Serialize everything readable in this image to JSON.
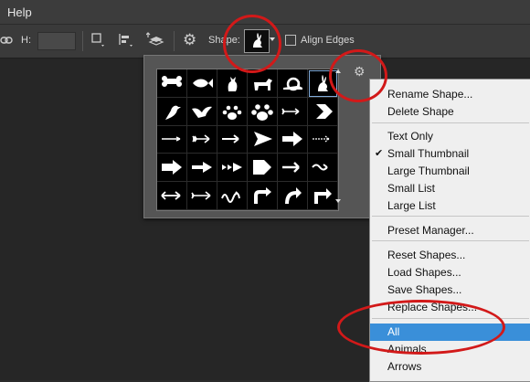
{
  "menubar": {
    "help_label": "Help"
  },
  "options": {
    "h_label": "H:",
    "shape_label": "Shape:",
    "align_edges_label": "Align Edges"
  },
  "shape_grid": {
    "rows": [
      [
        "bone",
        "fish",
        "cat",
        "dog",
        "snail",
        "rabbit"
      ],
      [
        "bird",
        "dove",
        "paw",
        "paw-print",
        "arrow-feathered",
        "chevron"
      ],
      [
        "arrow-thin",
        "arrow-feather",
        "arrow-line",
        "arrow-triangle",
        "arrow-bold",
        "arrow-dotted"
      ],
      [
        "arrow-block",
        "arrow-split",
        "arrow-triple",
        "arrow-pentagon",
        "arrow-plain",
        "arrow-wave"
      ],
      [
        "arrow-double",
        "arrow-double-line",
        "arrow-squiggle",
        "arrow-turn",
        "arrow-curve",
        "arrow-corner"
      ]
    ],
    "selected": "rabbit"
  },
  "menu": {
    "items": [
      {
        "label": "Rename Shape..."
      },
      {
        "label": "Delete Shape"
      },
      {
        "label": "Text Only"
      },
      {
        "label": "Small Thumbnail",
        "checked": true
      },
      {
        "label": "Large Thumbnail"
      },
      {
        "label": "Small List"
      },
      {
        "label": "Large List"
      },
      {
        "label": "Preset Manager..."
      },
      {
        "label": "Reset Shapes..."
      },
      {
        "label": "Load Shapes..."
      },
      {
        "label": "Save Shapes..."
      },
      {
        "label": "Replace Shapes..."
      },
      {
        "label": "All",
        "highlighted": true
      },
      {
        "label": "Animals"
      },
      {
        "label": "Arrows"
      }
    ],
    "check_mark": "✔"
  },
  "colors": {
    "highlight": "#3a8fd9",
    "annotation": "#d21919"
  }
}
